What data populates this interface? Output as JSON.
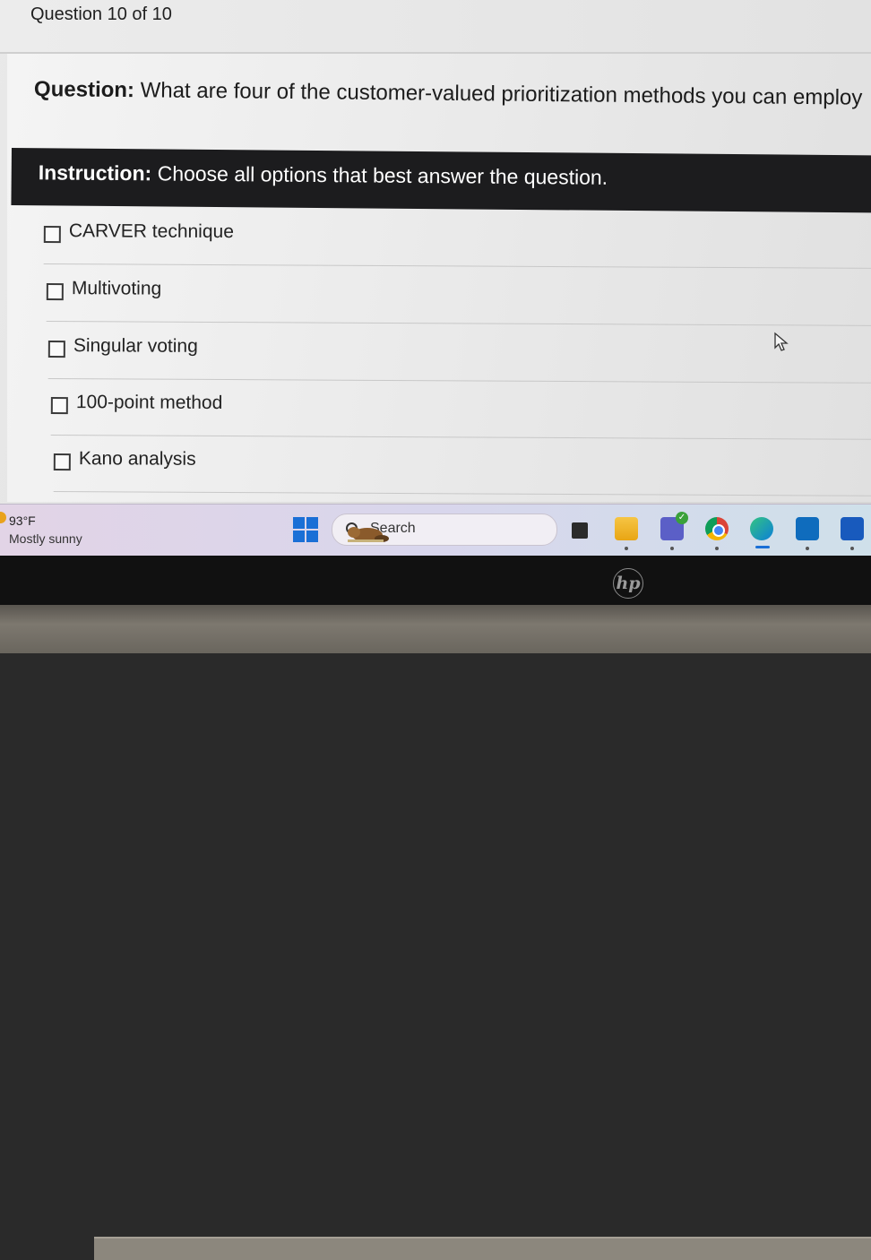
{
  "header": {
    "question_counter": "Question 10 of 10"
  },
  "question": {
    "label": "Question:",
    "text": " What are four of the customer-valued prioritization methods you can employ"
  },
  "instruction": {
    "label": "Instruction:",
    "text": " Choose all options that best answer the question."
  },
  "options": [
    {
      "label": "CARVER technique",
      "checked": false
    },
    {
      "label": "Multivoting",
      "checked": false
    },
    {
      "label": "Singular voting",
      "checked": false
    },
    {
      "label": "100-point method",
      "checked": false
    },
    {
      "label": "Kano analysis",
      "checked": false
    }
  ],
  "taskbar": {
    "weather_temp": "93°F",
    "weather_desc": "Mostly sunny",
    "search_label": "Search",
    "pinned_icons": [
      "task-view-icon",
      "file-explorer-icon",
      "teams-icon",
      "chrome-icon",
      "edge-icon",
      "outlook-icon",
      "word-icon"
    ]
  },
  "device": {
    "brand_logo": "hp"
  },
  "colors": {
    "instruction_bar": "#1c1c1e",
    "windows_blue": "#1a6fd6"
  }
}
